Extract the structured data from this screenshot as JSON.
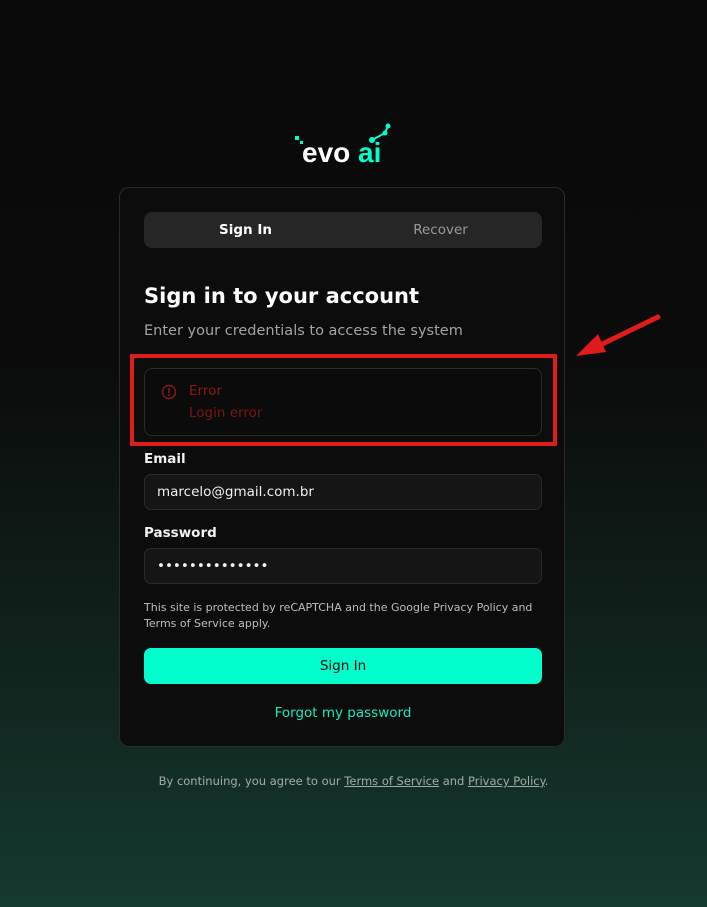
{
  "brand": {
    "logo_text_evo": "evo",
    "logo_text_ai": "ai",
    "accent_color": "#00ffcc"
  },
  "tabs": [
    {
      "label": "Sign In",
      "active": true
    },
    {
      "label": "Recover",
      "active": false
    }
  ],
  "form": {
    "title": "Sign in to your account",
    "subtitle": "Enter your credentials to access the system",
    "alert": {
      "icon": "alert-circle-icon",
      "title": "Error",
      "description": "Login error",
      "color": "#8b1a1a"
    },
    "email_label": "Email",
    "email_value": "marcelo@gmail.com.br",
    "password_label": "Password",
    "password_value": "••••••••••••••",
    "recaptcha_notice": "This site is protected by reCAPTCHA and the Google Privacy Policy and Terms of Service apply.",
    "submit_label": "Sign In",
    "forgot_label": "Forgot my password"
  },
  "footer": {
    "prefix": "By continuing, you agree to our ",
    "terms_label": "Terms of Service",
    "and": " and ",
    "privacy_label": "Privacy Policy",
    "suffix": "."
  },
  "annotation": {
    "color": "#e01b1b"
  }
}
